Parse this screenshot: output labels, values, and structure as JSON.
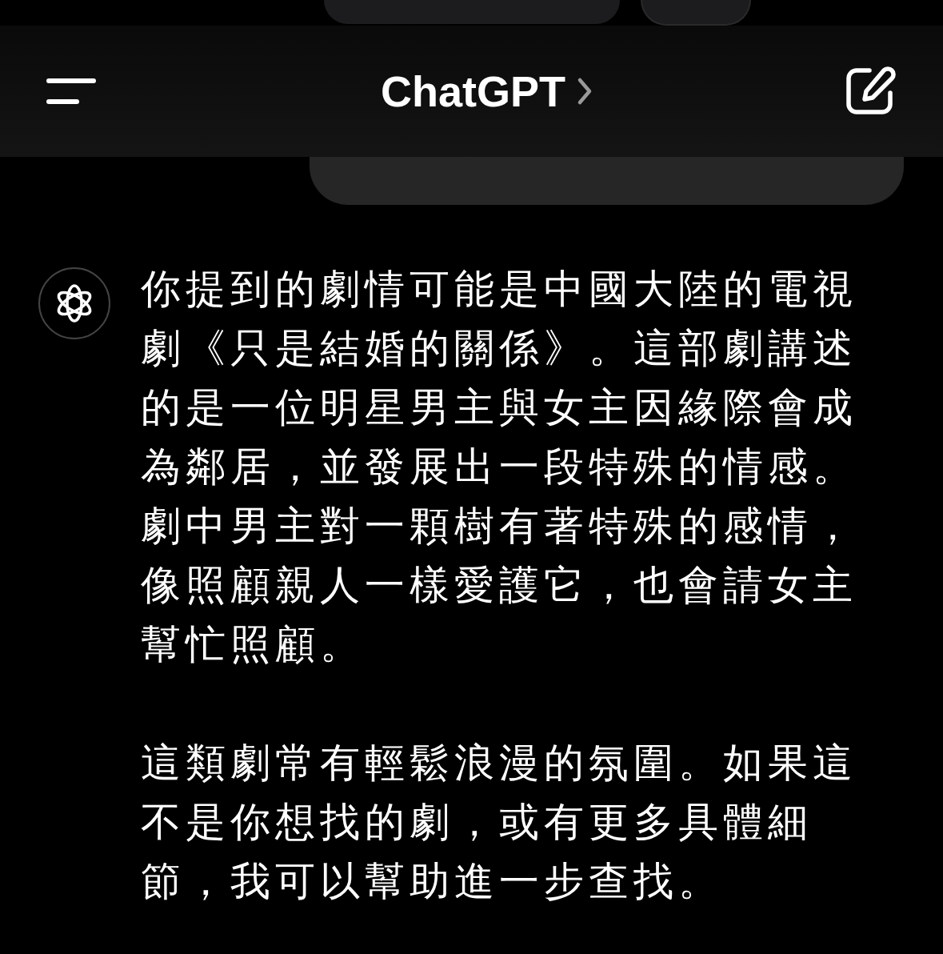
{
  "header": {
    "title": "ChatGPT"
  },
  "assistant_message": {
    "paragraphs": [
      "你提到的劇情可能是中國大陸的電視劇《只是結婚的關係》。這部劇講述的是一位明星男主與女主因緣際會成為鄰居，並發展出一段特殊的情感。劇中男主對一顆樹有著特殊的感情，像照顧親人一樣愛護它，也會請女主幫忙照顧。",
      "這類劇常有輕鬆浪漫的氛圍。如果這不是你想找的劇，或有更多具體細節，我可以幫助進一步查找。"
    ]
  }
}
